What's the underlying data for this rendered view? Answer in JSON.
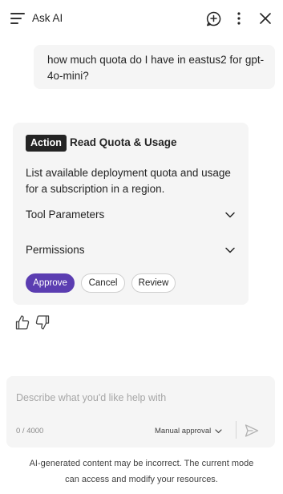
{
  "header": {
    "title": "Ask AI",
    "icons": [
      "hamburger-menu-icon",
      "new-chat-icon",
      "more-options-icon",
      "close-icon"
    ]
  },
  "user_message": {
    "text": "how much quota do I have in eastus2 for gpt-4o-mini?"
  },
  "action_card": {
    "badge": "Action",
    "title": "Read Quota & Usage",
    "description": "List available deployment quota and usage for a subscription in a region.",
    "sections": [
      {
        "label": "Tool Parameters",
        "expanded": false
      },
      {
        "label": "Permissions",
        "expanded": false
      }
    ],
    "buttons": {
      "approve": "Approve",
      "cancel": "Cancel",
      "review": "Review"
    },
    "accent_color": "#5b3db1"
  },
  "feedback": {
    "icons": [
      "thumbs-up-icon",
      "thumbs-down-icon"
    ]
  },
  "composer": {
    "placeholder": "Describe what you'd like help with",
    "value": "",
    "counter": "0 / 4000",
    "mode": "Manual approval"
  },
  "disclaimer": "AI-generated content may be incorrect. The current mode can access and modify your resources."
}
